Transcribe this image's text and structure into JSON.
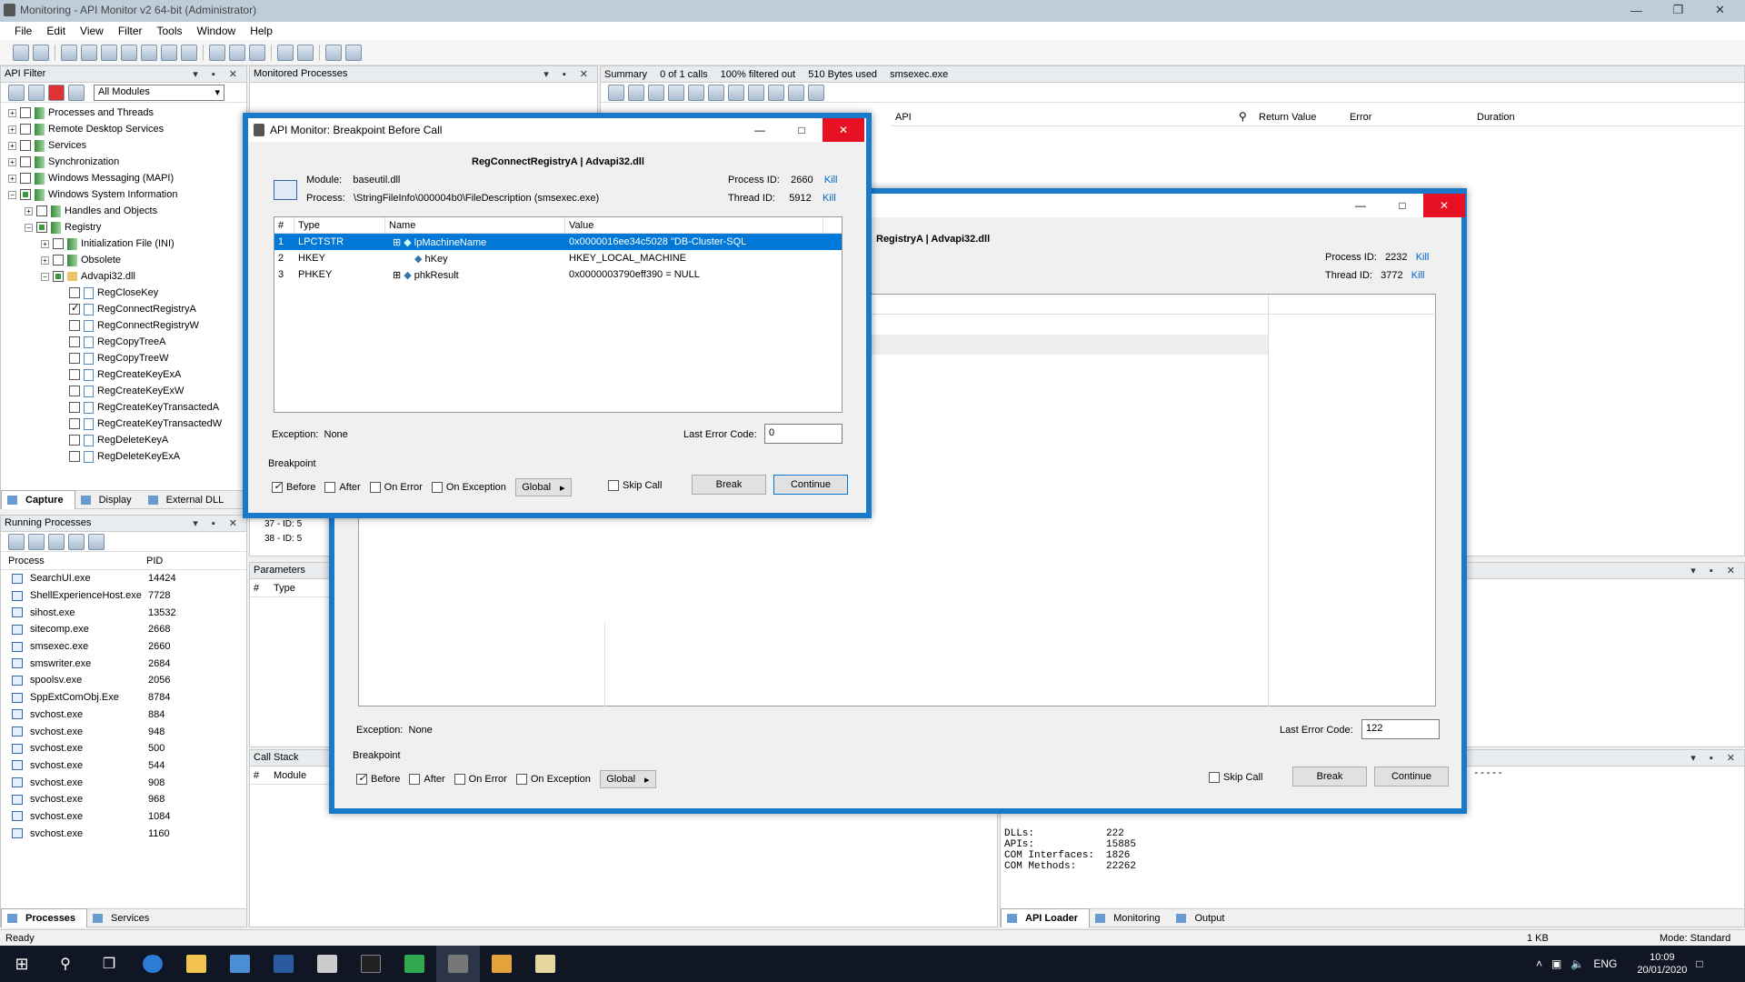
{
  "window": {
    "title": "Monitoring - API Monitor v2 64-bit (Administrator)"
  },
  "menu": [
    "File",
    "Edit",
    "View",
    "Filter",
    "Tools",
    "Window",
    "Help"
  ],
  "api_filter": {
    "title": "API Filter",
    "module_select": "All Modules",
    "tree": [
      {
        "label": "Processes and Threads",
        "indent": 0,
        "exp": "+",
        "check": "off",
        "icon": "ico"
      },
      {
        "label": "Remote Desktop Services",
        "indent": 0,
        "exp": "+",
        "check": "off",
        "icon": "ico"
      },
      {
        "label": "Services",
        "indent": 0,
        "exp": "+",
        "check": "off",
        "icon": "ico"
      },
      {
        "label": "Synchronization",
        "indent": 0,
        "exp": "+",
        "check": "off",
        "icon": "ico"
      },
      {
        "label": "Windows Messaging (MAPI)",
        "indent": 0,
        "exp": "+",
        "check": "off",
        "icon": "ico"
      },
      {
        "label": "Windows System Information",
        "indent": 0,
        "exp": "−",
        "check": "part",
        "icon": "ico"
      },
      {
        "label": "Handles and Objects",
        "indent": 1,
        "exp": "+",
        "check": "off",
        "icon": "ico"
      },
      {
        "label": "Registry",
        "indent": 1,
        "exp": "−",
        "check": "part",
        "icon": "ico"
      },
      {
        "label": "Initialization File (INI)",
        "indent": 2,
        "exp": "+",
        "check": "off",
        "icon": "ico"
      },
      {
        "label": "Obsolete",
        "indent": 2,
        "exp": "+",
        "check": "off",
        "icon": "ico"
      },
      {
        "label": "Advapi32.dll",
        "indent": 2,
        "exp": "−",
        "check": "part",
        "icon": "folder"
      },
      {
        "label": "RegCloseKey",
        "indent": 3,
        "exp": "",
        "check": "off",
        "icon": "api"
      },
      {
        "label": "RegConnectRegistryA",
        "indent": 3,
        "exp": "",
        "check": "on",
        "icon": "api"
      },
      {
        "label": "RegConnectRegistryW",
        "indent": 3,
        "exp": "",
        "check": "off",
        "icon": "api"
      },
      {
        "label": "RegCopyTreeA",
        "indent": 3,
        "exp": "",
        "check": "off",
        "icon": "api"
      },
      {
        "label": "RegCopyTreeW",
        "indent": 3,
        "exp": "",
        "check": "off",
        "icon": "api"
      },
      {
        "label": "RegCreateKeyExA",
        "indent": 3,
        "exp": "",
        "check": "off",
        "icon": "api"
      },
      {
        "label": "RegCreateKeyExW",
        "indent": 3,
        "exp": "",
        "check": "off",
        "icon": "api"
      },
      {
        "label": "RegCreateKeyTransactedA",
        "indent": 3,
        "exp": "",
        "check": "off",
        "icon": "api"
      },
      {
        "label": "RegCreateKeyTransactedW",
        "indent": 3,
        "exp": "",
        "check": "off",
        "icon": "api"
      },
      {
        "label": "RegDeleteKeyA",
        "indent": 3,
        "exp": "",
        "check": "off",
        "icon": "api"
      },
      {
        "label": "RegDeleteKeyExA",
        "indent": 3,
        "exp": "",
        "check": "off",
        "icon": "api"
      }
    ],
    "tabs": [
      "Capture",
      "Display",
      "External DLL"
    ]
  },
  "running": {
    "title": "Running Processes",
    "col_process": "Process",
    "col_pid": "PID",
    "rows": [
      [
        "SearchUI.exe",
        "14424"
      ],
      [
        "ShellExperienceHost.exe",
        "7728"
      ],
      [
        "sihost.exe",
        "13532"
      ],
      [
        "sitecomp.exe",
        "2668"
      ],
      [
        "smsexec.exe",
        "2660"
      ],
      [
        "smswriter.exe",
        "2684"
      ],
      [
        "spoolsv.exe",
        "2056"
      ],
      [
        "SppExtComObj.Exe",
        "8784"
      ],
      [
        "svchost.exe",
        "884"
      ],
      [
        "svchost.exe",
        "948"
      ],
      [
        "svchost.exe",
        "500"
      ],
      [
        "svchost.exe",
        "544"
      ],
      [
        "svchost.exe",
        "908"
      ],
      [
        "svchost.exe",
        "968"
      ],
      [
        "svchost.exe",
        "1084"
      ],
      [
        "svchost.exe",
        "1160"
      ]
    ],
    "tabs": [
      "Processes",
      "Services"
    ]
  },
  "monitored": {
    "title": "Monitored Processes",
    "frag1": "37 - ID: 5",
    "frag2": "38 - ID: 5"
  },
  "params": {
    "title": "Parameters",
    "col_num": "#",
    "col_type": "Type"
  },
  "callstack": {
    "title": "Call Stack",
    "col_num": "#",
    "col_module": "Module"
  },
  "summary": {
    "tab": "Summary",
    "calls": "0 of 1 calls",
    "filtered": "100% filtered out",
    "bytes": "510 Bytes used",
    "process": "smsexec.exe",
    "cols": [
      "API",
      "Return Value",
      "Error",
      "Duration"
    ]
  },
  "output": {
    "lines": [
      [
        "DLLs:",
        "222"
      ],
      [
        "APIs:",
        "15885"
      ],
      [
        "COM Interfaces:",
        "1826"
      ],
      [
        "COM Methods:",
        "22262"
      ]
    ],
    "dashes": "-----",
    "tabs": [
      "API Loader",
      "Monitoring",
      "Output"
    ]
  },
  "status": {
    "left": "Ready",
    "size": "1 KB",
    "mode": "Mode: Standard"
  },
  "dialog1": {
    "title": "API Monitor: Breakpoint Before Call",
    "heading": "RegConnectRegistryA | Advapi32.dll",
    "module_label": "Module:",
    "module": "baseutil.dll",
    "process_label": "Process:",
    "process": "\\StringFileInfo\\000004b0\\FileDescription (smsexec.exe)",
    "pid_label": "Process ID:",
    "pid": "2660",
    "tid_label": "Thread ID:",
    "tid": "5912",
    "kill": "Kill",
    "cols": [
      "#",
      "Type",
      "Name",
      "Value"
    ],
    "rows": [
      [
        "1",
        "LPCTSTR",
        "lpMachineName",
        "0x0000016ee34c5028 \"DB-Cluster-SQL"
      ],
      [
        "2",
        "HKEY",
        "hKey",
        "HKEY_LOCAL_MACHINE"
      ],
      [
        "3",
        "PHKEY",
        "phkResult",
        "0x0000003790eff390 = NULL"
      ]
    ],
    "exception_label": "Exception:",
    "exception": "None",
    "last_err_label": "Last Error Code:",
    "last_err": "0",
    "bp_label": "Breakpoint",
    "before": "Before",
    "after": "After",
    "on_error": "On Error",
    "on_exception": "On Exception",
    "global": "Global",
    "skip": "Skip Call",
    "break": "Break",
    "continue": "Continue"
  },
  "dialog2": {
    "heading": "RegistryA | Advapi32.dll",
    "pid_label": "Process ID:",
    "pid": "2232",
    "tid_label": "Thread ID:",
    "tid": "3772",
    "kill": "Kill",
    "exception_label": "Exception:",
    "exception": "None",
    "last_err_label": "Last Error Code:",
    "last_err": "122",
    "bp_label": "Breakpoint",
    "before": "Before",
    "after": "After",
    "on_error": "On Error",
    "on_exception": "On Exception",
    "global": "Global",
    "skip": "Skip Call",
    "break": "Break",
    "continue": "Continue",
    "e_frag": "E"
  },
  "taskbar": {
    "lang": "ENG",
    "time": "10:09",
    "date": "20/01/2020"
  }
}
